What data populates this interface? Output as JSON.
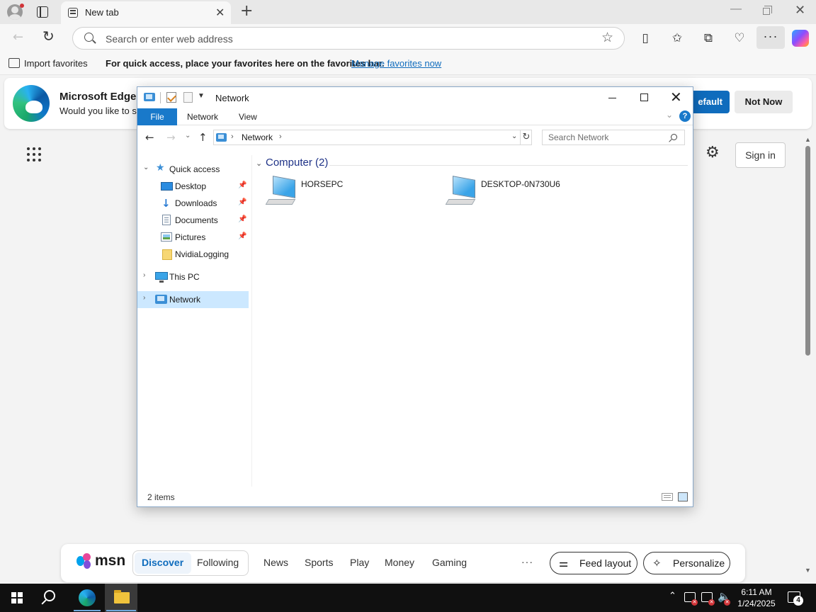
{
  "edge": {
    "tab_title": "New tab",
    "address_placeholder": "Search or enter web address",
    "favorites_bar": {
      "import_label": "Import favorites",
      "message": "For quick access, place your favorites here on the favorites bar.",
      "link": "Manage favorites now"
    },
    "banner": {
      "title": "Microsoft Edge",
      "subtitle": "Would you like to se",
      "default_button": "efault",
      "not_now_button": "Not Now"
    },
    "sign_in": "Sign in",
    "msn": {
      "logo_text": "msn",
      "tabs": [
        "Discover",
        "Following"
      ],
      "nav": [
        "News",
        "Sports",
        "Play",
        "Money",
        "Gaming"
      ],
      "more": "···",
      "feed_layout": "Feed layout",
      "personalize": "Personalize"
    }
  },
  "explorer": {
    "title": "Network",
    "ribbon": [
      "File",
      "Network",
      "View"
    ],
    "help": "?",
    "address": "Network",
    "search_placeholder": "Search Network",
    "nav_pane": {
      "quick_access": "Quick access",
      "items": [
        "Desktop",
        "Downloads",
        "Documents",
        "Pictures",
        "NvidiaLogging"
      ],
      "this_pc": "This PC",
      "network": "Network"
    },
    "group_header": "Computer (2)",
    "computers": [
      "HORSEPC",
      "DESKTOP-0N730U6"
    ],
    "status": "2 items"
  },
  "taskbar": {
    "time": "6:11 AM",
    "date": "1/24/2025",
    "notification_count": "4"
  }
}
